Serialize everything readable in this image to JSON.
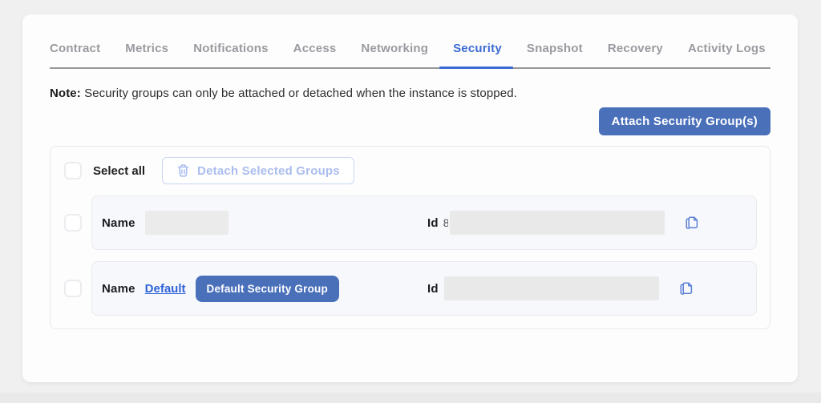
{
  "tabs": [
    {
      "label": "Contract",
      "active": false
    },
    {
      "label": "Metrics",
      "active": false
    },
    {
      "label": "Notifications",
      "active": false
    },
    {
      "label": "Access",
      "active": false
    },
    {
      "label": "Networking",
      "active": false
    },
    {
      "label": "Security",
      "active": true
    },
    {
      "label": "Snapshot",
      "active": false
    },
    {
      "label": "Recovery",
      "active": false
    },
    {
      "label": "Activity Logs",
      "active": false
    }
  ],
  "note": {
    "label": "Note:",
    "text": " Security groups can only be attached or detached when the instance is stopped."
  },
  "toolbar": {
    "attach_label": "Attach Security Group(s)"
  },
  "panel": {
    "select_all_label": "Select all",
    "detach_label": "Detach Selected Groups",
    "rows": [
      {
        "name_label": "Name",
        "name_value_redacted": true,
        "id_label": "Id",
        "id_visible_prefix": "8",
        "id_value_redacted": true
      },
      {
        "name_label": "Name",
        "name_link": "Default",
        "badge": "Default Security Group",
        "id_label": "Id",
        "id_value_redacted": true
      }
    ]
  },
  "icons": {
    "detach_button_icon": "trash-icon",
    "row_copy_icon": "copy-icon"
  },
  "colors": {
    "accent_blue": "#4a70ba",
    "active_tab_blue": "#3c6cd3",
    "link_blue": "#2f63d8",
    "disabled_blue": "#aabdee",
    "page_background": "#f0f0f1",
    "row_background": "#f7f8fb",
    "redaction_gray": "#e9e9e9"
  }
}
